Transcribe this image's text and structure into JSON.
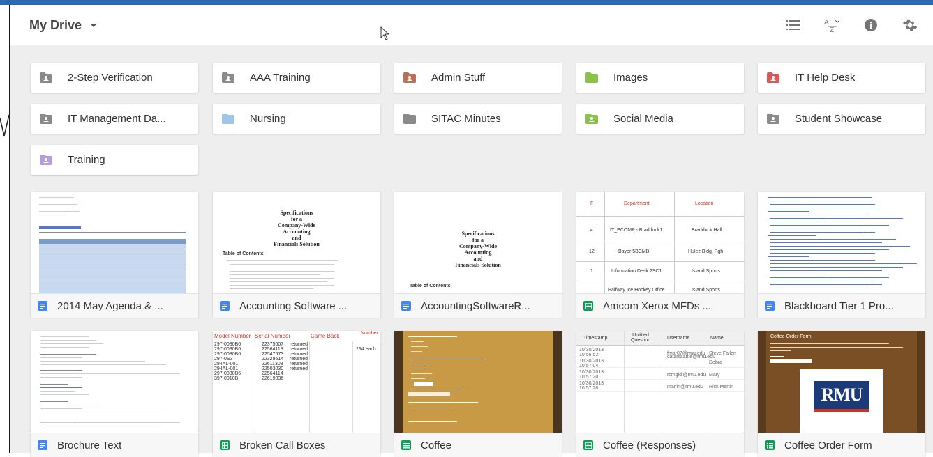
{
  "header": {
    "title": "My Drive",
    "icons": [
      "list-view-icon",
      "sort-az-icon",
      "info-icon",
      "settings-icon"
    ]
  },
  "folders": [
    {
      "name": "2-Step Verification",
      "color": "#8a8a8a",
      "shared": true
    },
    {
      "name": "AAA Training",
      "color": "#8a8a8a",
      "shared": true
    },
    {
      "name": "Admin Stuff",
      "color": "#b5735a",
      "shared": true
    },
    {
      "name": "Images",
      "color": "#8bc34a",
      "shared": false
    },
    {
      "name": "IT Help Desk",
      "color": "#d65a5a",
      "shared": true
    },
    {
      "name": "IT Management Da...",
      "color": "#8a8a8a",
      "shared": true
    },
    {
      "name": "Nursing",
      "color": "#9fc5e8",
      "shared": false
    },
    {
      "name": "SITAC Minutes",
      "color": "#8a8a8a",
      "shared": false
    },
    {
      "name": "Social Media",
      "color": "#8bc34a",
      "shared": true
    },
    {
      "name": "Student Showcase",
      "color": "#8a8a8a",
      "shared": true
    },
    {
      "name": "Training",
      "color": "#b39ddb",
      "shared": true
    }
  ],
  "files": [
    {
      "name": "2014 May Agenda & ...",
      "type": "doc"
    },
    {
      "name": "Accounting Software ...",
      "type": "doc"
    },
    {
      "name": "AccountingSoftwareR...",
      "type": "doc"
    },
    {
      "name": "Amcom Xerox MFDs ...",
      "type": "sheet"
    },
    {
      "name": "Blackboard Tier 1 Pro...",
      "type": "doc"
    },
    {
      "name": "Brochure Text",
      "type": "doc"
    },
    {
      "name": "Broken Call Boxes",
      "type": "sheet"
    },
    {
      "name": "Coffee",
      "type": "form"
    },
    {
      "name": "Coffee (Responses)",
      "type": "sheet"
    },
    {
      "name": "Coffee Order Form",
      "type": "form"
    }
  ],
  "thumbs": {
    "spec_title": "Specifications\nfor a\nCompany-Wide\nAccounting\nand\nFinancials Solution",
    "toc": "Table of Contents",
    "xerox_headers": [
      "Department",
      "Location"
    ],
    "xerox_rows": [
      [
        "4",
        "IT_ECOMP - Braddock1",
        "Braddock Hall"
      ],
      [
        "12",
        "Bayer 5BCMB",
        "Hulez Bldg, Pgh"
      ],
      [
        "1",
        "Information Desk 2SC1",
        "Island Sports"
      ],
      [
        "",
        "Halfway Ice Hockey Office",
        "Island Sports"
      ]
    ],
    "callbox_headers": [
      "Model Number",
      "Serial Number",
      "Came Back",
      "Number"
    ],
    "callbox_rows": [
      [
        "297-0030B6",
        "22375607",
        "returned"
      ],
      [
        "297-0030B6",
        "22564113",
        "returned"
      ],
      [
        "297-0030B6",
        "22547673",
        "returned"
      ],
      [
        "297-0S3",
        "22329514",
        "returned"
      ],
      [
        "294AL-001",
        "22611308",
        "returned"
      ],
      [
        "294AL-001",
        "22503030",
        "returned"
      ],
      [
        "297-0030B6",
        "22564114",
        ""
      ],
      [
        "397-0010B",
        "22619036",
        ""
      ]
    ],
    "callbox_note": "294 each",
    "responses_headers": [
      "Timestamp",
      "Untitled Question",
      "Username",
      "Name"
    ],
    "responses_rows": [
      [
        "10/30/2013 10:56:52",
        "fmar07@rmu.edu",
        "Steve Fallen"
      ],
      [
        "10/30/2013 10:57:04",
        "cataniaartie@rmu.edu",
        "Debra"
      ],
      [
        "10/30/2013 10:57:20",
        "rcmgldi@rmu.edu",
        "Mary"
      ],
      [
        "10/30/2013 10:57:28",
        "marlin@rmu.edu",
        "Rick Martin"
      ]
    ],
    "coffee_form_title": "Coffee Order Form",
    "coffee_logo": "RMU"
  }
}
